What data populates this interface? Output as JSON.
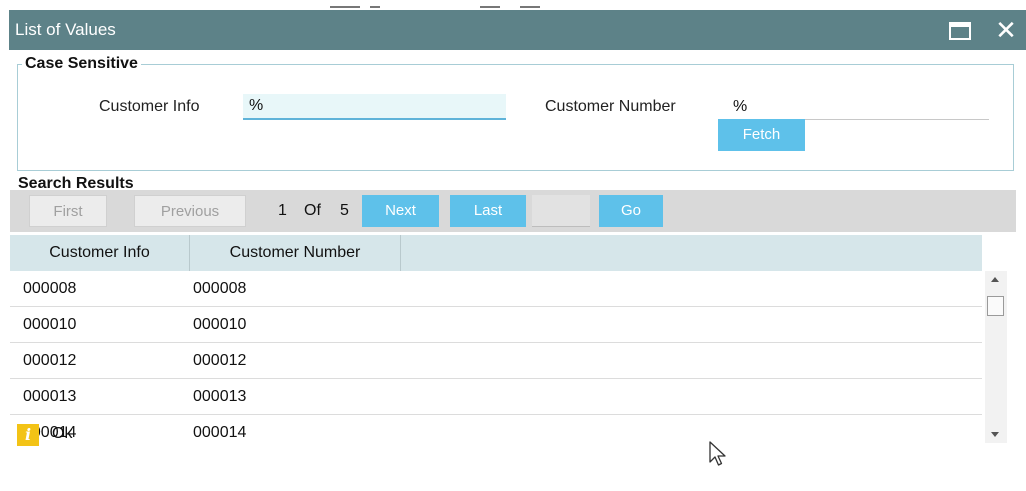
{
  "window": {
    "title": "List of Values"
  },
  "criteria": {
    "legend": "Case Sensitive",
    "customer_info_label": "Customer Info",
    "customer_info_value": "%",
    "customer_number_label": "Customer Number",
    "customer_number_value": "%",
    "fetch_label": "Fetch"
  },
  "results": {
    "title": "Search Results",
    "pager": {
      "first_label": "First",
      "previous_label": "Previous",
      "current_page": "1",
      "of_label": "Of",
      "total_pages": "5",
      "next_label": "Next",
      "last_label": "Last",
      "go_label": "Go"
    },
    "columns": [
      "Customer Info",
      "Customer Number"
    ],
    "rows": [
      {
        "customer_info": "000008",
        "customer_number": "000008"
      },
      {
        "customer_info": "000010",
        "customer_number": "000010"
      },
      {
        "customer_info": "000012",
        "customer_number": "000012"
      },
      {
        "customer_info": "000013",
        "customer_number": "000013"
      },
      {
        "customer_info": "000014",
        "customer_number": "000014"
      }
    ]
  },
  "footer": {
    "icon": "info-icon",
    "ok_label": "Ok"
  },
  "colors": {
    "titlebar": "#5d8288",
    "accent_button": "#5ec1ea",
    "header_row": "#d6e6ea",
    "info_icon": "#f3c316"
  }
}
